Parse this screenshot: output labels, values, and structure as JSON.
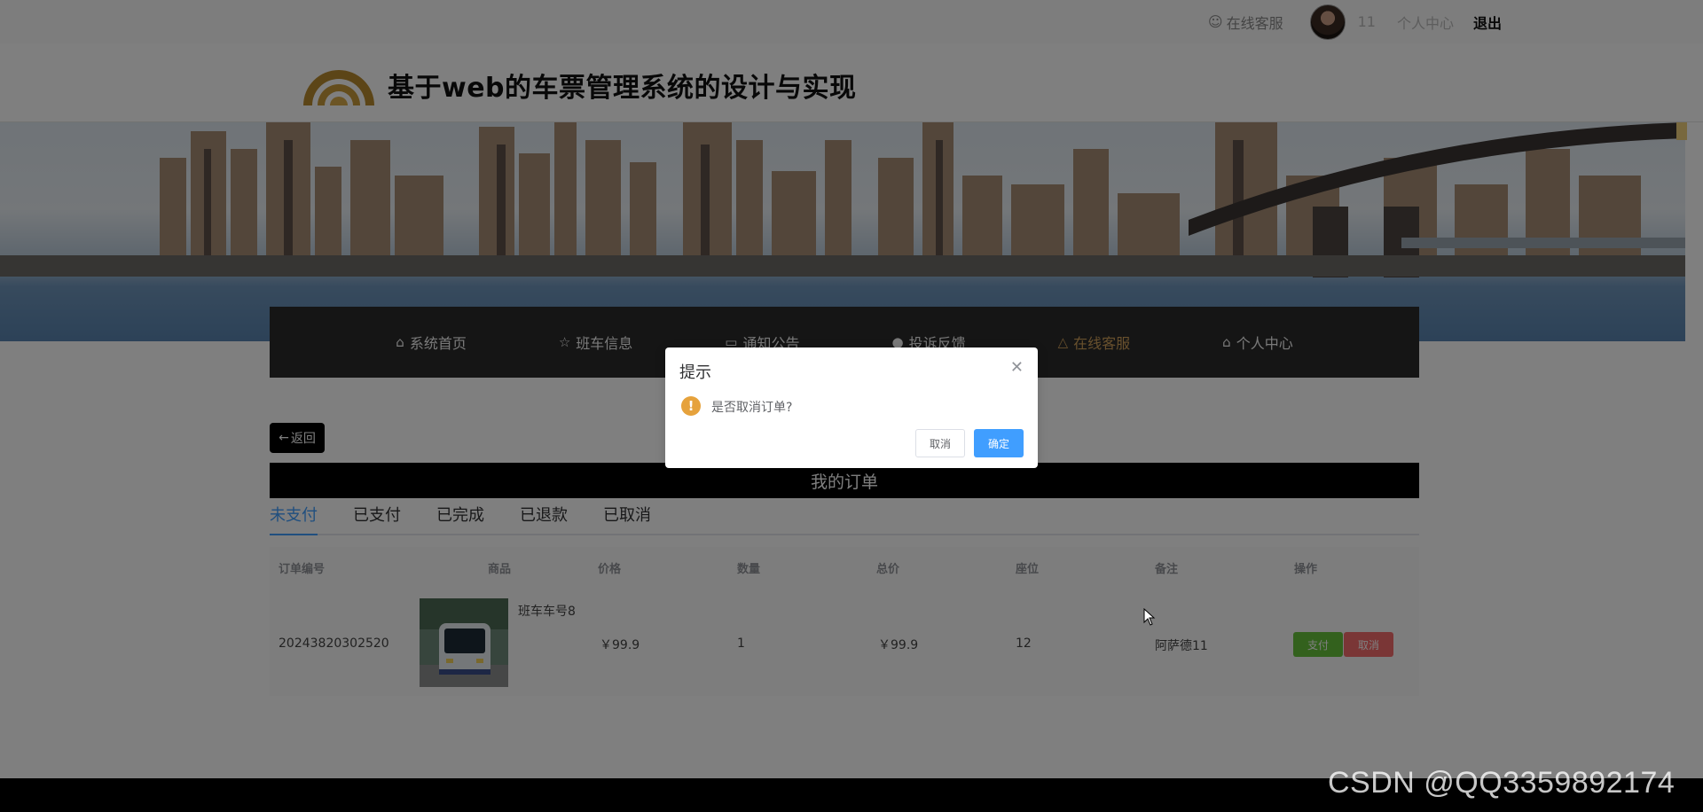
{
  "topbar": {
    "service_label": "在线客服",
    "user_name": "11",
    "user_center": "个人中心",
    "logout": "退出"
  },
  "header": {
    "title": "基于web的车票管理系统的设计与实现"
  },
  "nav": {
    "items": [
      {
        "icon": "home-icon",
        "label": "系统首页"
      },
      {
        "icon": "star-icon",
        "label": "班车信息"
      },
      {
        "icon": "notice-icon",
        "label": "通知公告"
      },
      {
        "icon": "info-icon",
        "label": "投诉反馈"
      },
      {
        "icon": "service-icon",
        "label": "在线客服"
      },
      {
        "icon": "home-icon",
        "label": "个人中心"
      }
    ],
    "active": "在线客服"
  },
  "back_button": "返回",
  "orders": {
    "title": "我的订单",
    "tabs": [
      "未支付",
      "已支付",
      "已完成",
      "已退款",
      "已取消"
    ],
    "active_tab": "未支付",
    "columns": [
      "订单编号",
      "商品",
      "价格",
      "数量",
      "总价",
      "座位",
      "备注",
      "操作"
    ],
    "rows": [
      {
        "order_no": "20243820302520",
        "product": "班车车号8",
        "price": "￥99.9",
        "quantity": "1",
        "total": "￥99.9",
        "seat": "12",
        "remark": "阿萨德11",
        "pay_label": "支付",
        "cancel_label": "取消"
      }
    ]
  },
  "dialog": {
    "title": "提示",
    "message": "是否取消订单?",
    "cancel": "取消",
    "confirm": "确定"
  },
  "colors": {
    "primary": "#409eff",
    "success": "#67c23a",
    "danger": "#f56c6c",
    "warning": "#e6a23c",
    "nav_bg": "#2b2b2b",
    "nav_active": "#d1a05a"
  },
  "watermark": "CSDN @QQ3359892174"
}
